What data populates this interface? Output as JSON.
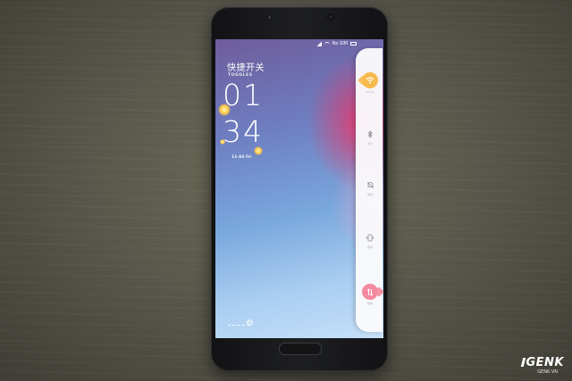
{
  "screen": {
    "status": {
      "carrier": "No SIM"
    },
    "title": "快捷开关",
    "subtitle": "TOGGLES",
    "clock": {
      "hour": "01",
      "minute": "34"
    },
    "date": "11-04 Fri"
  },
  "toggles": {
    "wifi": {
      "label": "WLAN",
      "active": true,
      "color": "#f6b94a"
    },
    "bluetooth": {
      "label": "蓝牙"
    },
    "silent": {
      "label": "静音"
    },
    "vibrate": {
      "label": "振动"
    },
    "data": {
      "label": "数据",
      "active": true,
      "color": "#f48aa0"
    }
  },
  "icons": [
    "wifi-icon",
    "bluetooth-icon",
    "bell-off-icon",
    "vibrate-icon",
    "data-arrows-icon",
    "gear-icon"
  ],
  "watermark": {
    "brand": "GENK",
    "url": "GENK.VN"
  }
}
